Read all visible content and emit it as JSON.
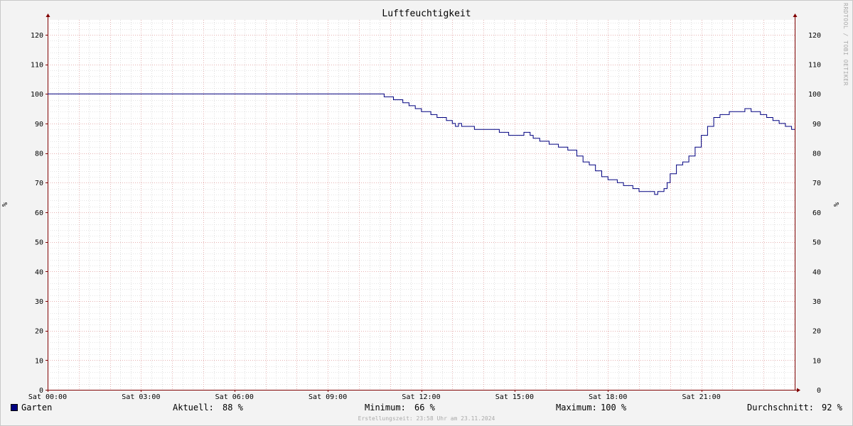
{
  "watermark": "RRDTOOL / TOBI OETIKER",
  "footer": "Erstellungszeit: 23:58 Uhr am 23.11.2024",
  "legend": {
    "series_name": "Garten",
    "aktuell_label": "Aktuell:",
    "aktuell_value": "88 %",
    "minimum_label": "Minimum:",
    "minimum_value": "66 %",
    "maximum_label": "Maximum:",
    "maximum_value": "100 %",
    "avg_label": "Durchschnitt:",
    "avg_value": "92 %"
  },
  "colors": {
    "line": "#000080",
    "grid_major": "#e8a0a0",
    "grid_minor": "#c8c8c8",
    "axis": "#800000",
    "plot_bg": "#ffffff"
  },
  "chart_data": {
    "type": "line",
    "title": "Luftfeuchtigkeit",
    "ylabel": "%",
    "ylabel_right": "%",
    "xlim": [
      0,
      24
    ],
    "ylim": [
      0,
      125
    ],
    "y_ticks": [
      0,
      10,
      20,
      30,
      40,
      50,
      60,
      70,
      80,
      90,
      100,
      110,
      120
    ],
    "x_ticks": [
      {
        "value": 0,
        "label": "Sat 00:00"
      },
      {
        "value": 3,
        "label": "Sat 03:00"
      },
      {
        "value": 6,
        "label": "Sat 06:00"
      },
      {
        "value": 9,
        "label": "Sat 09:00"
      },
      {
        "value": 12,
        "label": "Sat 12:00"
      },
      {
        "value": 15,
        "label": "Sat 15:00"
      },
      {
        "value": 18,
        "label": "Sat 18:00"
      },
      {
        "value": 21,
        "label": "Sat 21:00"
      }
    ],
    "grid": true,
    "series": [
      {
        "name": "Garten",
        "x": [
          0,
          10.8,
          10.81,
          11.1,
          11.11,
          11.4,
          11.41,
          11.6,
          11.61,
          11.8,
          11.81,
          12.0,
          12.01,
          12.3,
          12.31,
          12.5,
          12.51,
          12.8,
          12.81,
          13.0,
          13.1,
          13.2,
          13.3,
          13.4,
          13.5,
          13.7,
          13.71,
          14.0,
          14.5,
          14.51,
          14.8,
          14.81,
          15.2,
          15.3,
          15.5,
          15.6,
          15.8,
          15.81,
          16.1,
          16.11,
          16.4,
          16.41,
          16.7,
          16.71,
          17.0,
          17.2,
          17.4,
          17.6,
          17.8,
          18.0,
          18.3,
          18.5,
          18.8,
          19.0,
          19.2,
          19.5,
          19.6,
          19.8,
          19.9,
          20.0,
          20.2,
          20.4,
          20.6,
          20.8,
          21.0,
          21.2,
          21.4,
          21.6,
          21.9,
          22.2,
          22.4,
          22.6,
          22.9,
          23.1,
          23.3,
          23.5,
          23.7,
          23.9,
          24.0
        ],
        "values": [
          100,
          100,
          99,
          99,
          98,
          98,
          97,
          97,
          96,
          96,
          95,
          95,
          94,
          94,
          93,
          93,
          92,
          92,
          91,
          90,
          89,
          90,
          89,
          89,
          89,
          89,
          88,
          88,
          88,
          87,
          87,
          86,
          86,
          87,
          86,
          85,
          85,
          84,
          84,
          83,
          83,
          82,
          82,
          81,
          79,
          77,
          76,
          74,
          72,
          71,
          70,
          69,
          68,
          67,
          67,
          66,
          67,
          68,
          70,
          73,
          76,
          77,
          79,
          82,
          86,
          89,
          92,
          93,
          94,
          94,
          95,
          94,
          93,
          92,
          91,
          90,
          89,
          88,
          88
        ]
      }
    ]
  }
}
